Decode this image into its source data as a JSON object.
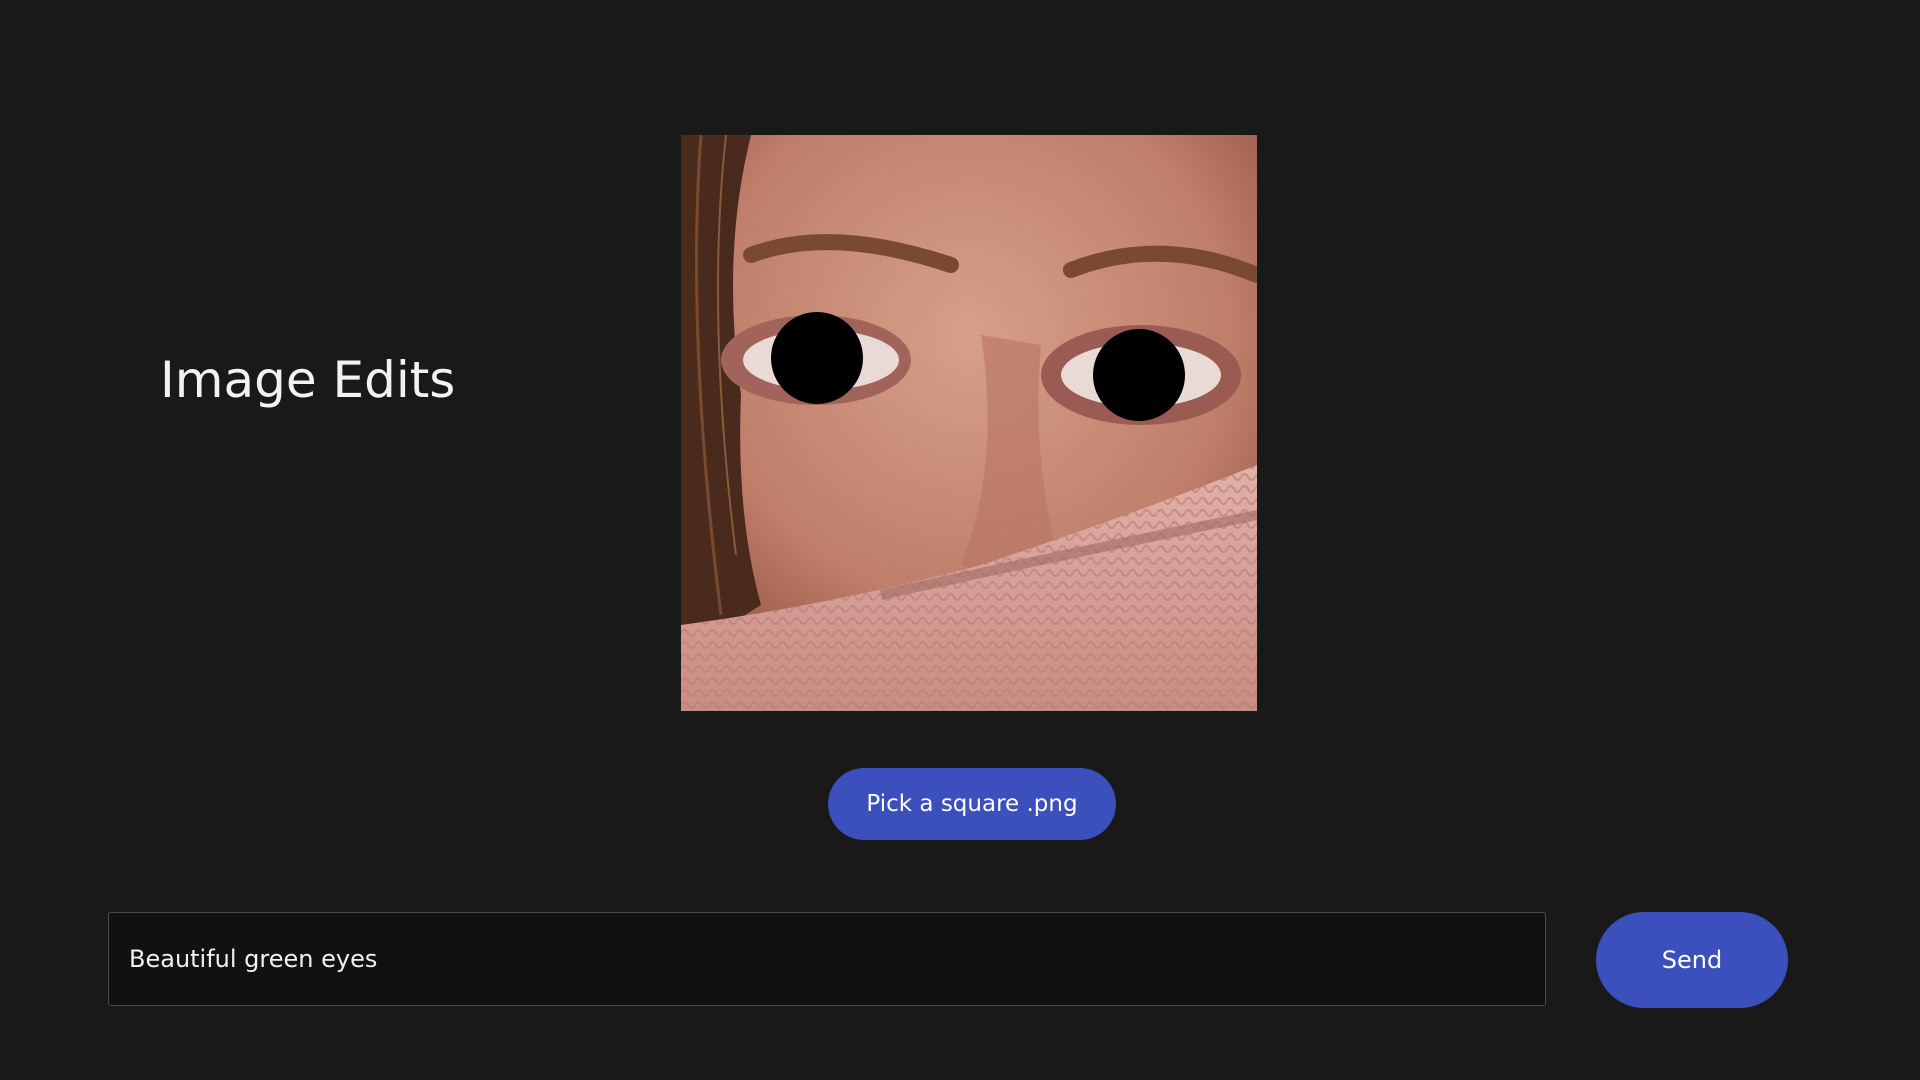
{
  "app": {
    "title": "Image Edits"
  },
  "image": {
    "alt": "Photo of a face with black mask circles over the eyes",
    "colors": {
      "skin": "#c98f7a",
      "sweater": "#d9a39b",
      "hair": "#5a3322",
      "brow": "#7a4a30",
      "mask": "#000000"
    }
  },
  "picker": {
    "label": "Pick a square .png"
  },
  "prompt": {
    "value": "Beautiful green eyes",
    "placeholder": ""
  },
  "send": {
    "label": "Send"
  },
  "colors": {
    "background": "#19191a",
    "accent": "#3b4fbd",
    "field_background": "#111113",
    "field_border": "#4a4a4c"
  }
}
